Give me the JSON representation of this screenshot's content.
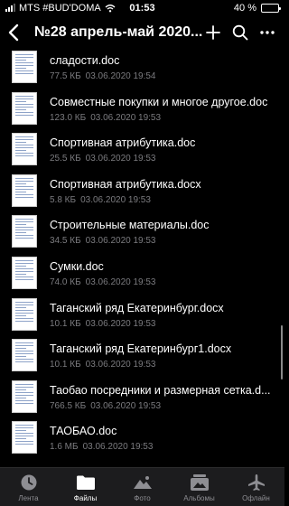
{
  "status_bar": {
    "carrier": "MTS #BUD'DOMA",
    "time": "01:53",
    "battery_text": "40 %",
    "battery_level": 0.4
  },
  "nav": {
    "title": "№28 апрель-май 2020..."
  },
  "files": [
    {
      "name": "сладости.doc",
      "size": "77.5 КБ",
      "date": "03.06.2020 19:54"
    },
    {
      "name": "Совместные покупки и многое другое.doc",
      "size": "123.0 КБ",
      "date": "03.06.2020 19:53"
    },
    {
      "name": "Спортивная атрибутика.doc",
      "size": "25.5 КБ",
      "date": "03.06.2020 19:53"
    },
    {
      "name": "Спортивная атрибутика.docx",
      "size": "5.8 КБ",
      "date": "03.06.2020 19:53"
    },
    {
      "name": "Строительные материалы.doc",
      "size": "34.5 КБ",
      "date": "03.06.2020 19:53"
    },
    {
      "name": "Сумки.doc",
      "size": "74.0 КБ",
      "date": "03.06.2020 19:53"
    },
    {
      "name": "Таганский ряд Екатеринбург.docx",
      "size": "10.1 КБ",
      "date": "03.06.2020 19:53"
    },
    {
      "name": "Таганский ряд Екатеринбург1.docx",
      "size": "10.1 КБ",
      "date": "03.06.2020 19:53"
    },
    {
      "name": "Таобао посредники и размерная сетка.d...",
      "size": "766.5 КБ",
      "date": "03.06.2020 19:53"
    },
    {
      "name": "ТАОБАО.doc",
      "size": "1.6 МБ",
      "date": "03.06.2020 19:53"
    }
  ],
  "tabs": [
    {
      "label": "Лента",
      "icon": "clock-icon",
      "active": false
    },
    {
      "label": "Файлы",
      "icon": "folder-icon",
      "active": true
    },
    {
      "label": "Фото",
      "icon": "mountain-photo-icon",
      "active": false
    },
    {
      "label": "Альбомы",
      "icon": "albums-icon",
      "active": false
    },
    {
      "label": "Офлайн",
      "icon": "airplane-icon",
      "active": false
    }
  ]
}
